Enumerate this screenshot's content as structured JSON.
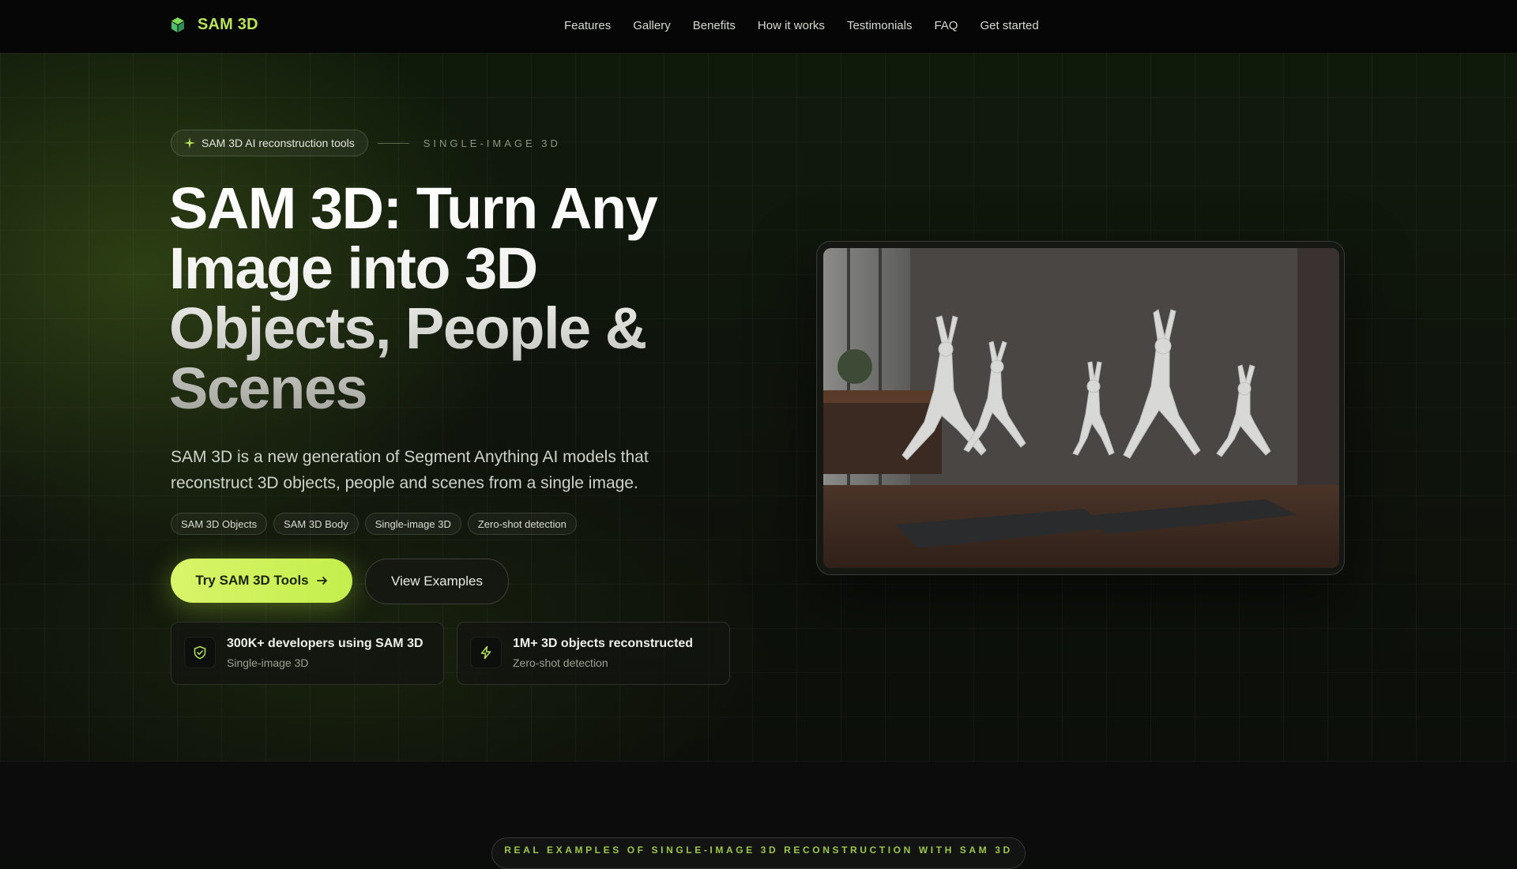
{
  "brand": {
    "name": "SAM 3D",
    "icon": "cube-logo-icon",
    "accent": "#b9e35a"
  },
  "nav": [
    "Features",
    "Gallery",
    "Benefits",
    "How it works",
    "Testimonials",
    "FAQ",
    "Get started"
  ],
  "hero": {
    "badge": "SAM 3D AI reconstruction tools",
    "tagline": "SINGLE-IMAGE 3D",
    "title_line1": "SAM 3D: Turn Any",
    "title_line2": "Image into 3D",
    "title_line3": "Objects, People &",
    "title_line4": "Scenes",
    "subtitle": "SAM 3D is a new generation of Segment Anything AI models that reconstruct 3D objects, people and scenes from a single image.",
    "chips": [
      "SAM 3D Objects",
      "SAM 3D Body",
      "Single-image 3D",
      "Zero-shot detection"
    ],
    "primary_cta": "Try SAM 3D Tools",
    "secondary_cta": "View Examples",
    "stats": [
      {
        "title": "300K+ developers using SAM 3D",
        "subtitle": "Single-image 3D",
        "icon": "shield-check-icon"
      },
      {
        "title": "1M+ 3D objects reconstructed",
        "subtitle": "Zero-shot detection",
        "icon": "lightning-icon"
      }
    ]
  },
  "examples_badge": "REAL EXAMPLES OF SINGLE-IMAGE 3D RECONSTRUCTION WITH SAM 3D",
  "colors": {
    "background": "#0b0d0a",
    "accent": "#c3ef4c",
    "header": "#050605"
  }
}
